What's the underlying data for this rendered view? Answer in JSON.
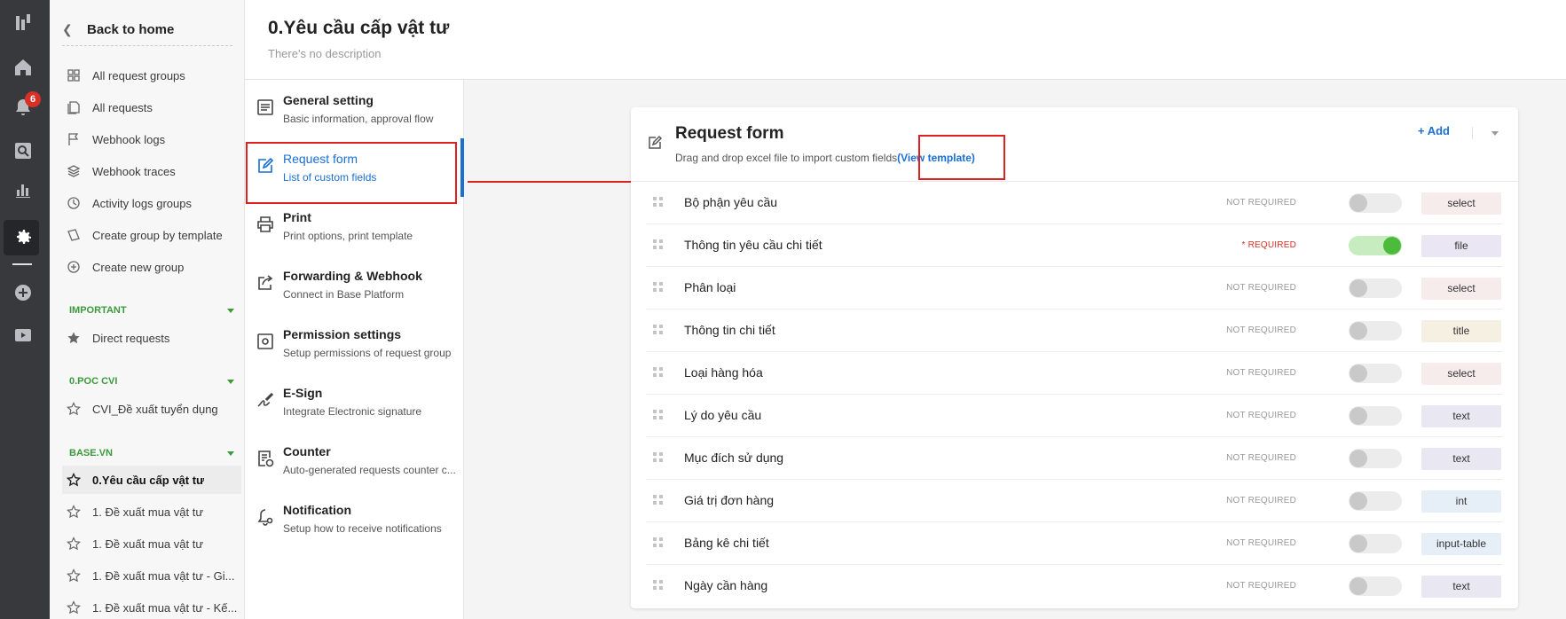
{
  "rail": {
    "notification_count": "6"
  },
  "nav": {
    "back_label": "Back to home",
    "items": [
      {
        "label": "All request groups",
        "icon": "grid-icon"
      },
      {
        "label": "All requests",
        "icon": "copy-icon"
      },
      {
        "label": "Webhook logs",
        "icon": "flag-icon"
      },
      {
        "label": "Webhook traces",
        "icon": "layers-icon"
      },
      {
        "label": "Activity logs groups",
        "icon": "clock-icon"
      },
      {
        "label": "Create group by template",
        "icon": "template-icon"
      },
      {
        "label": "Create new group",
        "icon": "plus-circle-icon"
      }
    ],
    "sections": [
      {
        "title": "IMPORTANT",
        "items": [
          {
            "label": "Direct requests",
            "starred": true
          }
        ]
      },
      {
        "title": "0.POC CVI",
        "items": [
          {
            "label": "CVI_Đề xuất tuyển dụng",
            "starred": false
          }
        ]
      },
      {
        "title": "BASE.VN",
        "items": [
          {
            "label": "0.Yêu cầu cấp vật tư",
            "current": true
          },
          {
            "label": "1. Đề xuất mua vật tư"
          },
          {
            "label": "1. Đề xuất mua vật tư"
          },
          {
            "label": "1. Đề xuất mua vật tư - Gi..."
          },
          {
            "label": "1. Đề xuất mua vật tư - Kế..."
          }
        ]
      }
    ]
  },
  "header": {
    "title": "0.Yêu cầu cấp vật tư",
    "description": "There's no description"
  },
  "settings_menu": [
    {
      "title": "General setting",
      "subtitle": "Basic information, approval flow",
      "icon": "document-icon"
    },
    {
      "title": "Request form",
      "subtitle": "List of custom fields",
      "icon": "edit-icon",
      "active": true
    },
    {
      "title": "Print",
      "subtitle": "Print options, print template",
      "icon": "printer-icon"
    },
    {
      "title": "Forwarding & Webhook",
      "subtitle": "Connect in Base Platform",
      "icon": "share-icon"
    },
    {
      "title": "Permission settings",
      "subtitle": "Setup permissions of request group",
      "icon": "permission-icon"
    },
    {
      "title": "E-Sign",
      "subtitle": "Integrate Electronic signature",
      "icon": "signature-icon"
    },
    {
      "title": "Counter",
      "subtitle": "Auto-generated requests counter c...",
      "icon": "counter-icon"
    },
    {
      "title": "Notification",
      "subtitle": "Setup how to receive notifications",
      "icon": "bell-icon"
    }
  ],
  "form": {
    "title": "Request form",
    "subtitle": "Drag and drop excel file to import custom fields",
    "view_template": "(View template)",
    "add_label": "+ Add",
    "fields": [
      {
        "name": "Bộ phận yêu cầu",
        "required_label": "NOT REQUIRED",
        "required": false,
        "type": "select"
      },
      {
        "name": "Thông tin yêu cầu chi tiết",
        "required_label": "* REQUIRED",
        "required": true,
        "type": "file"
      },
      {
        "name": "Phân loại",
        "required_label": "NOT REQUIRED",
        "required": false,
        "type": "select"
      },
      {
        "name": "Thông tin chi tiết",
        "required_label": "NOT REQUIRED",
        "required": false,
        "type": "title"
      },
      {
        "name": "Loại hàng hóa",
        "required_label": "NOT REQUIRED",
        "required": false,
        "type": "select"
      },
      {
        "name": "Lý do yêu cầu",
        "required_label": "NOT REQUIRED",
        "required": false,
        "type": "text"
      },
      {
        "name": "Mục đích sử dụng",
        "required_label": "NOT REQUIRED",
        "required": false,
        "type": "text"
      },
      {
        "name": "Giá trị đơn hàng",
        "required_label": "NOT REQUIRED",
        "required": false,
        "type": "int"
      },
      {
        "name": "Bảng kê chi tiết",
        "required_label": "NOT REQUIRED",
        "required": false,
        "type": "input-table"
      },
      {
        "name": "Ngày cần hàng",
        "required_label": "NOT REQUIRED",
        "required": false,
        "type": "text"
      }
    ]
  },
  "colors": {
    "accent": "#1a6fd1",
    "section_green": "#3b9b3b",
    "toggle_on": "#4cbb3c",
    "required_red": "#d93025",
    "annotation_red": "#e01f1f",
    "type_select": "#f6ecec",
    "type_file": "#ebe6f3",
    "type_title": "#f6f0e2",
    "type_text": "#e9e7f2",
    "type_int": "#e6eef7",
    "type_input-table": "#e6eef7"
  }
}
